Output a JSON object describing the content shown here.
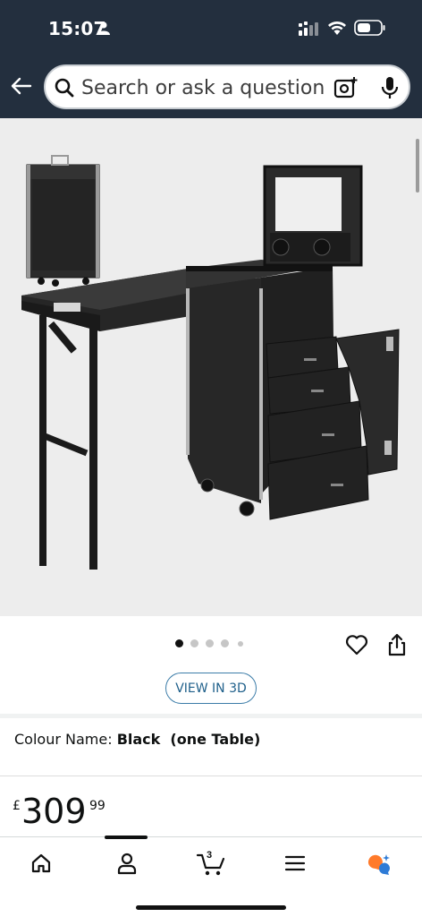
{
  "status_bar": {
    "time": "15:07"
  },
  "search": {
    "placeholder": "Search or ask a question"
  },
  "gallery": {
    "image_alt": "Black folding makeup vanity table trolley case with drawers and mirror",
    "dots_count": 5,
    "active_dot": 0
  },
  "actions": {
    "view_3d_label": "VIEW IN 3D"
  },
  "variation": {
    "label": "Colour Name:",
    "value": "Black  (one Table)"
  },
  "price": {
    "currency": "£",
    "whole": "309",
    "fraction": "99"
  },
  "bottom_nav": {
    "cart_count": "3"
  },
  "colors": {
    "header_bg": "#232f3e",
    "link_blue": "#1e5f8a",
    "rufus_orange": "#ff7a2a",
    "rufus_blue": "#2e7bd6"
  }
}
